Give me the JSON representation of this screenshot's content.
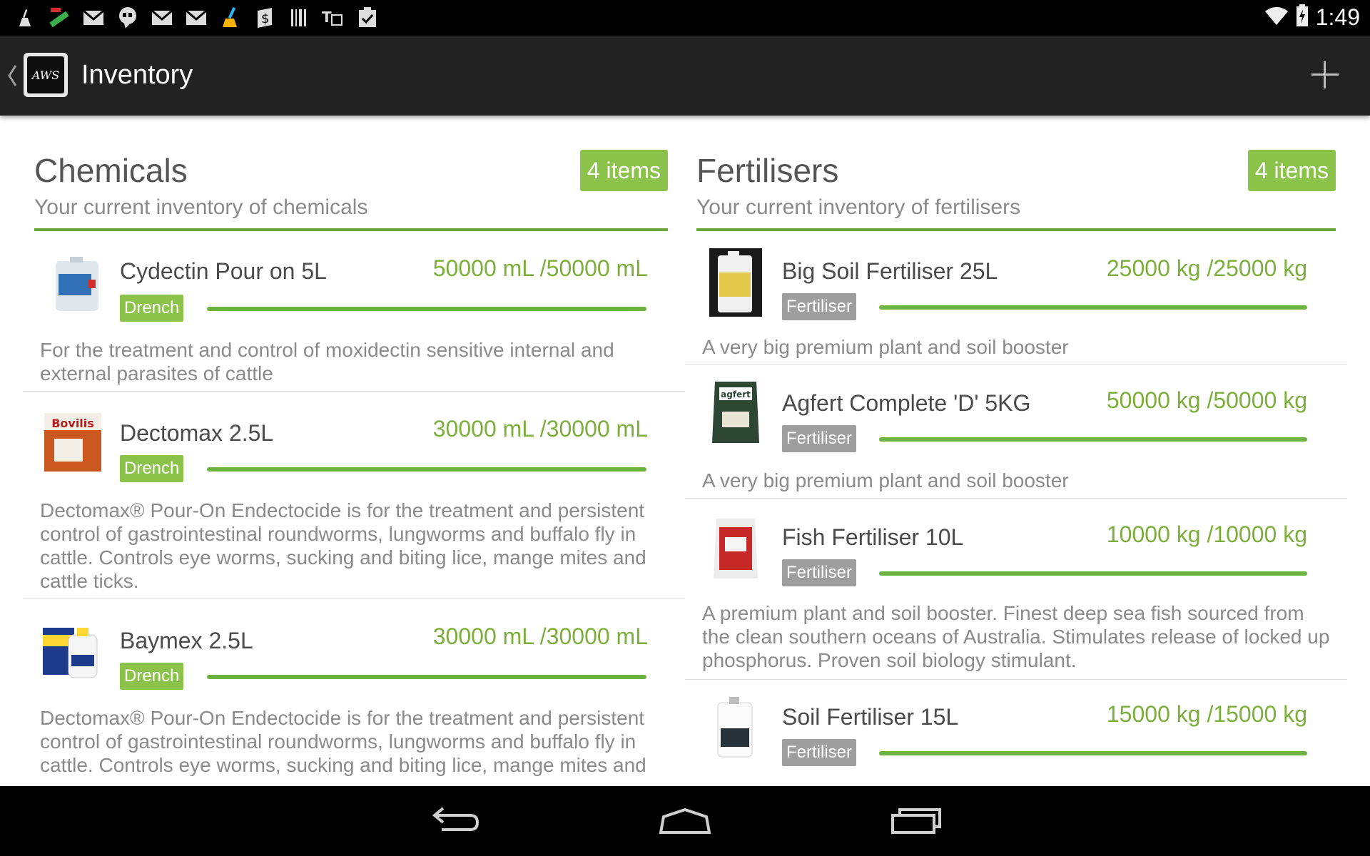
{
  "status_bar": {
    "time": "1:49",
    "icons": [
      "sweep-icon",
      "fail-app-icon",
      "gmail-icon",
      "hangouts-icon",
      "gmail-icon",
      "gmail-icon",
      "cleaner-icon",
      "money-icon",
      "barcode-icon",
      "translate-icon",
      "clipboard-check-icon"
    ]
  },
  "action_bar": {
    "title": "Inventory",
    "logo_text": "AWS"
  },
  "sections": [
    {
      "title": "Chemicals",
      "subtitle": "Your current inventory of chemicals",
      "badge": "4 items",
      "items": [
        {
          "name": "Cydectin Pour on 5L",
          "quantity": "50000 mL /50000 mL",
          "level": 1.0,
          "tag": "Drench",
          "description": "For the treatment and control of moxidectin sensitive internal and external parasites of cattle"
        },
        {
          "name": "Dectomax 2.5L",
          "quantity": "30000 mL /30000 mL",
          "level": 1.0,
          "tag": "Drench",
          "description": "Dectomax® Pour-On Endectocide is for the treatment and persistent control of gastrointestinal roundworms, lungworms and buffalo fly in cattle. Controls eye worms, sucking and biting lice, mange mites and cattle ticks."
        },
        {
          "name": "Baymex 2.5L",
          "quantity": "30000 mL /30000 mL",
          "level": 1.0,
          "tag": "Drench",
          "description": "Dectomax® Pour-On Endectocide is for the treatment and persistent control of gastrointestinal roundworms, lungworms and buffalo fly in cattle. Controls eye worms, sucking and biting lice, mange mites and"
        }
      ]
    },
    {
      "title": "Fertilisers",
      "subtitle": "Your current inventory of fertilisers",
      "badge": "4 items",
      "items": [
        {
          "name": "Big Soil Fertiliser 25L",
          "quantity": "25000 kg /25000 kg",
          "level": 1.0,
          "tag": "Fertiliser",
          "description": "A very big premium plant and soil booster"
        },
        {
          "name": "Agfert Complete 'D' 5KG",
          "quantity": "50000 kg /50000 kg",
          "level": 1.0,
          "tag": "Fertiliser",
          "description": "A very big premium plant and soil booster"
        },
        {
          "name": "Fish Fertiliser 10L",
          "quantity": "10000 kg /10000 kg",
          "level": 1.0,
          "tag": "Fertiliser",
          "description": "A premium plant and soil booster. Finest deep sea fish sourced from the clean southern oceans of Australia. Stimulates release of locked up phosphorus. Proven soil biology stimulant."
        },
        {
          "name": "Soil Fertiliser 15L",
          "quantity": "15000 kg /15000 kg",
          "level": 1.0,
          "tag": "Fertiliser",
          "description": ""
        }
      ]
    }
  ],
  "colors": {
    "accent": "#8bc34a",
    "accent_dark": "#6aa53a",
    "quantity_text": "#7cae3b",
    "action_bar": "#222222",
    "tag_grey": "#9e9e9e"
  }
}
